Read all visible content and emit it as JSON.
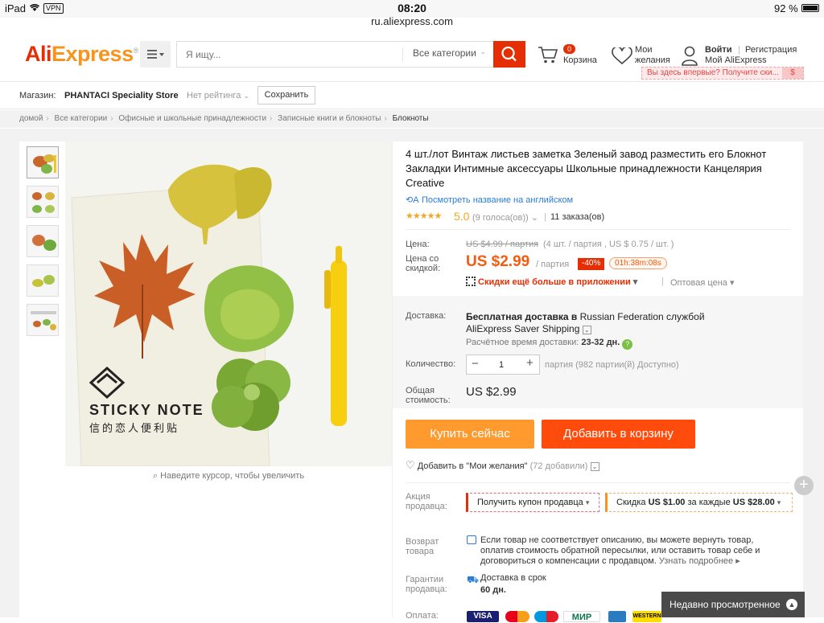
{
  "status": {
    "device": "iPad",
    "vpn": "VPN",
    "time": "08:20",
    "battery": "92 %",
    "url": "ru.aliexpress.com"
  },
  "header": {
    "logo_a": "Ali",
    "logo_b": "Express",
    "logo_tm": "®",
    "search_placeholder": "Я ищу...",
    "search_category": "Все категории",
    "cart_label": "Корзина",
    "cart_count": "0",
    "wishlist_line1": "Мои",
    "wishlist_line2": "желания",
    "login": "Войти",
    "register": "Регистрация",
    "my_ali": "Мой AliExpress",
    "promo": "Вы здесь впервые? Получите ски...",
    "promo_coin": "$"
  },
  "store": {
    "label": "Магазин:",
    "name": "PHANTACI Speciality Store",
    "rating": "Нет рейтинга",
    "save": "Сохранить"
  },
  "breadcrumb": [
    "домой",
    "Все категории",
    "Офисные и школьные принадлежности",
    "Записные книги и блокноты",
    "Блокноты"
  ],
  "product": {
    "title": "4 шт./лот Винтаж листьев заметка Зеленый завод разместить его Блокнот Закладки Интимные аксессуары Школьные принадлежности Канцелярия Creative",
    "translate": "Посмотреть название на английском",
    "rating": "5.0",
    "votes": "(9 голоса(ов))",
    "orders": "11 заказа(ов)",
    "image_text1": "STICKY NOTE",
    "image_text2": "信的恋人便利贴",
    "zoom_hint": "Наведите курсор, чтобы увеличить"
  },
  "price": {
    "label": "Цена:",
    "old": "US $4.99 / партия",
    "old_detail": "(4 шт. / партия , US $ 0.75 / шт. )",
    "sale_label_1": "Цена со",
    "sale_label_2": "скидкой:",
    "sale": "US $2.99",
    "unit": "/ партия",
    "discount": "-40%",
    "timer": "01h:38m:08s",
    "app": "Скидки ещё больше в приложении",
    "wholesale": "Оптовая цена"
  },
  "shipping": {
    "label": "Доставка:",
    "line1_bold": "Бесплатная доставка в ",
    "line1_country": "Russian Federation службой",
    "line2": "AliExpress Saver Shipping",
    "time_label": "Расчётное время доставки:",
    "time_value": "23-32 дн."
  },
  "quantity": {
    "label": "Количество:",
    "value": "1",
    "available": "партия (982 партии(й) Доступно)"
  },
  "total": {
    "label_1": "Общая",
    "label_2": "стоимость:",
    "value": "US $2.99"
  },
  "actions": {
    "buy": "Купить сейчас",
    "add_cart": "Добавить в корзину",
    "wish": "Добавить в \"Мои желания\"",
    "wish_count": "(72 добавили)"
  },
  "promo_seller": {
    "label_1": "Акция",
    "label_2": "продавца:",
    "coupon": "Получить купон продавца",
    "discount_pre": "Скидка ",
    "discount_amt": "US $1.00",
    "discount_mid": " за каждые ",
    "discount_total": "US $28.00"
  },
  "returns": {
    "label_1": "Возврат",
    "label_2": "товара",
    "line1": "Если товар не соответствует описанию, вы можете вернуть товар,",
    "line2": "оплатив стоимость обратной пересылки, или оставить товар себе и",
    "line3": "договориться о компенсации с продавцом.",
    "more": "Узнать подробнее"
  },
  "guarantee": {
    "label_1": "Гарантии",
    "label_2": "продавца:",
    "line1": "Доставка в срок",
    "line2": "60 дн."
  },
  "payment": {
    "label": "Оплата:",
    "cards": [
      "VISA",
      "MasterCard",
      "Maestro",
      "МИР",
      "",
      "WESTERN"
    ]
  },
  "recent": "Недавно просмотренное",
  "colors": {
    "accent": "#e62e04",
    "orange": "#f7941d",
    "buy": "#ff9a2e",
    "cart": "#ff4b0b"
  }
}
